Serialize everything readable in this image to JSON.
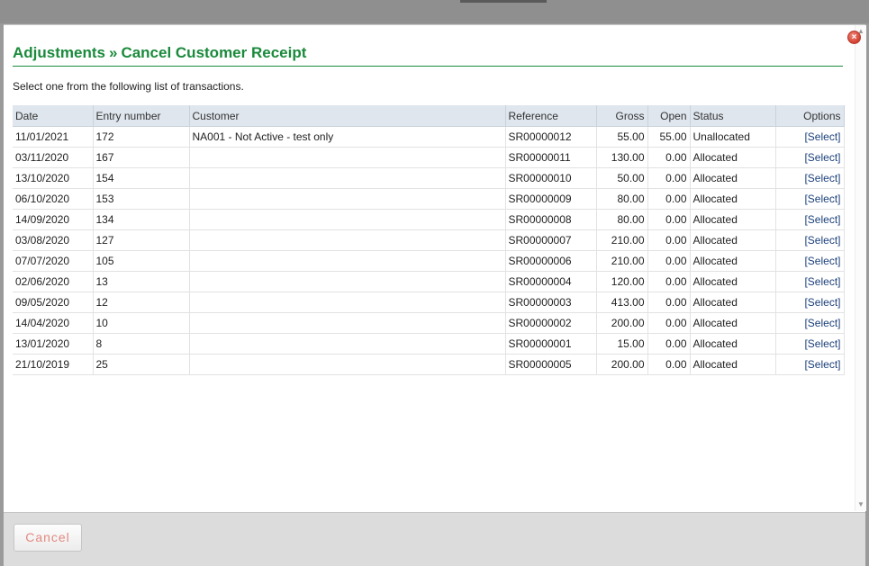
{
  "dialog": {
    "title_part1": "Adjustments",
    "title_sep": "»",
    "title_part2": "Cancel Customer Receipt",
    "instruction": "Select one from the following list of transactions.",
    "close_glyph": "×"
  },
  "table": {
    "headers": [
      "Date",
      "Entry number",
      "Customer",
      "Reference",
      "Gross",
      "Open",
      "Status",
      "Options"
    ],
    "rows": [
      {
        "date": "11/01/2021",
        "entry": "172",
        "customer": "NA001 - Not Active - test only",
        "reference": "SR00000012",
        "gross": "55.00",
        "open": "55.00",
        "status": "Unallocated",
        "option": "[Select]"
      },
      {
        "date": "03/11/2020",
        "entry": "167",
        "customer": "",
        "reference": "SR00000011",
        "gross": "130.00",
        "open": "0.00",
        "status": "Allocated",
        "option": "[Select]"
      },
      {
        "date": "13/10/2020",
        "entry": "154",
        "customer": "",
        "reference": "SR00000010",
        "gross": "50.00",
        "open": "0.00",
        "status": "Allocated",
        "option": "[Select]"
      },
      {
        "date": "06/10/2020",
        "entry": "153",
        "customer": "",
        "reference": "SR00000009",
        "gross": "80.00",
        "open": "0.00",
        "status": "Allocated",
        "option": "[Select]"
      },
      {
        "date": "14/09/2020",
        "entry": "134",
        "customer": "",
        "reference": "SR00000008",
        "gross": "80.00",
        "open": "0.00",
        "status": "Allocated",
        "option": "[Select]"
      },
      {
        "date": "03/08/2020",
        "entry": "127",
        "customer": "",
        "reference": "SR00000007",
        "gross": "210.00",
        "open": "0.00",
        "status": "Allocated",
        "option": "[Select]"
      },
      {
        "date": "07/07/2020",
        "entry": "105",
        "customer": "",
        "reference": "SR00000006",
        "gross": "210.00",
        "open": "0.00",
        "status": "Allocated",
        "option": "[Select]"
      },
      {
        "date": "02/06/2020",
        "entry": "13",
        "customer": "",
        "reference": "SR00000004",
        "gross": "120.00",
        "open": "0.00",
        "status": "Allocated",
        "option": "[Select]"
      },
      {
        "date": "09/05/2020",
        "entry": "12",
        "customer": "",
        "reference": "SR00000003",
        "gross": "413.00",
        "open": "0.00",
        "status": "Allocated",
        "option": "[Select]"
      },
      {
        "date": "14/04/2020",
        "entry": "10",
        "customer": "",
        "reference": "SR00000002",
        "gross": "200.00",
        "open": "0.00",
        "status": "Allocated",
        "option": "[Select]"
      },
      {
        "date": "13/01/2020",
        "entry": "8",
        "customer": "",
        "reference": "SR00000001",
        "gross": "15.00",
        "open": "0.00",
        "status": "Allocated",
        "option": "[Select]"
      },
      {
        "date": "21/10/2019",
        "entry": "25",
        "customer": "",
        "reference": "SR00000005",
        "gross": "200.00",
        "open": "0.00",
        "status": "Allocated",
        "option": "[Select]"
      }
    ]
  },
  "footer": {
    "cancel_label": "Cancel"
  },
  "colors": {
    "heading_green": "#1a8a3c",
    "header_bg": "#dfe6ee",
    "link_blue": "#1a3f7a",
    "cancel_text": "#e28a80"
  },
  "icons": {
    "close": "close-icon",
    "scroll_up": "scroll-up-arrow-icon",
    "scroll_down": "scroll-down-arrow-icon"
  }
}
